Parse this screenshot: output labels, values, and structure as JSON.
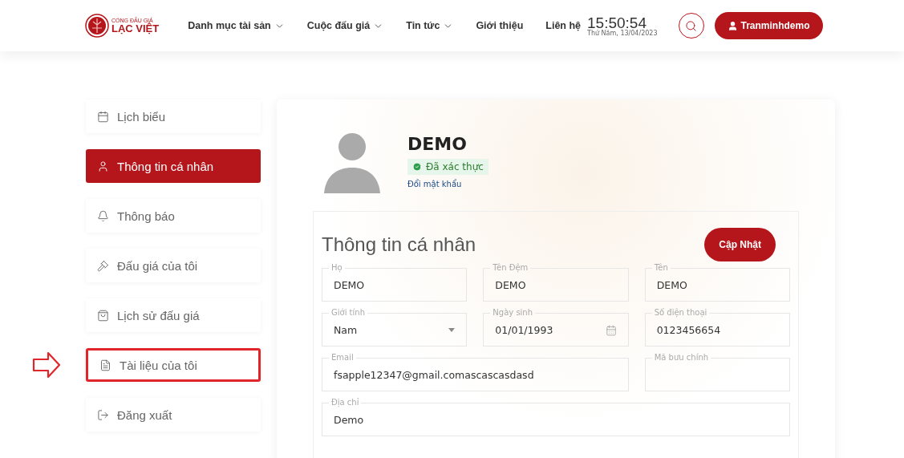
{
  "header": {
    "logo": {
      "top": "CỔNG ĐẤU GIÁ",
      "bottom": "LẠC VIỆT"
    },
    "nav": [
      {
        "label": "Danh mục tài sản",
        "dropdown": true
      },
      {
        "label": "Cuộc đấu giá",
        "dropdown": true
      },
      {
        "label": "Tin tức",
        "dropdown": true
      },
      {
        "label": "Giới thiệu",
        "dropdown": false
      },
      {
        "label": "Liên hệ",
        "dropdown": false
      }
    ],
    "clock": {
      "time": "15:50:54",
      "date": "Thứ Năm, 13/04/2023"
    },
    "user_button": "Tranminhdemo"
  },
  "sidebar": {
    "items": [
      {
        "label": "Lịch biểu",
        "selected": false,
        "highlighted": false
      },
      {
        "label": "Thông tin cá nhân",
        "selected": true,
        "highlighted": false
      },
      {
        "label": "Thông báo",
        "selected": false,
        "highlighted": false
      },
      {
        "label": "Đấu giá của tôi",
        "selected": false,
        "highlighted": false
      },
      {
        "label": "Lịch sử đấu giá",
        "selected": false,
        "highlighted": false
      },
      {
        "label": "Tài liệu của tôi",
        "selected": false,
        "highlighted": true
      },
      {
        "label": "Đăng xuất",
        "selected": false,
        "highlighted": false
      }
    ]
  },
  "profile": {
    "name": "DEMO",
    "verified": true,
    "verified_label": "Đã xác thực",
    "change_password": "Đổi mật khẩu"
  },
  "form": {
    "title": "Thông tin cá nhân",
    "update_button": "Cập Nhật",
    "fields": [
      {
        "label": "Họ",
        "value": "DEMO",
        "kind": "text"
      },
      {
        "label": "Tên Đệm",
        "value": "DEMO",
        "kind": "text"
      },
      {
        "label": "Tên",
        "value": "DEMO",
        "kind": "text"
      },
      {
        "label": "Giới tính",
        "value": "Nam",
        "kind": "select"
      },
      {
        "label": "Ngày sinh",
        "value": "01/01/1993",
        "kind": "date"
      },
      {
        "label": "Số điện thoại",
        "value": "0123456654",
        "kind": "text"
      },
      {
        "label": "Email",
        "value": "fsapple12347@gmail.comascascasdasd",
        "kind": "text"
      },
      {
        "label": "Mã bưu chính",
        "kind": "text"
      },
      {
        "label": "Địa chỉ",
        "value": "Demo",
        "kind": "text"
      }
    ]
  }
}
